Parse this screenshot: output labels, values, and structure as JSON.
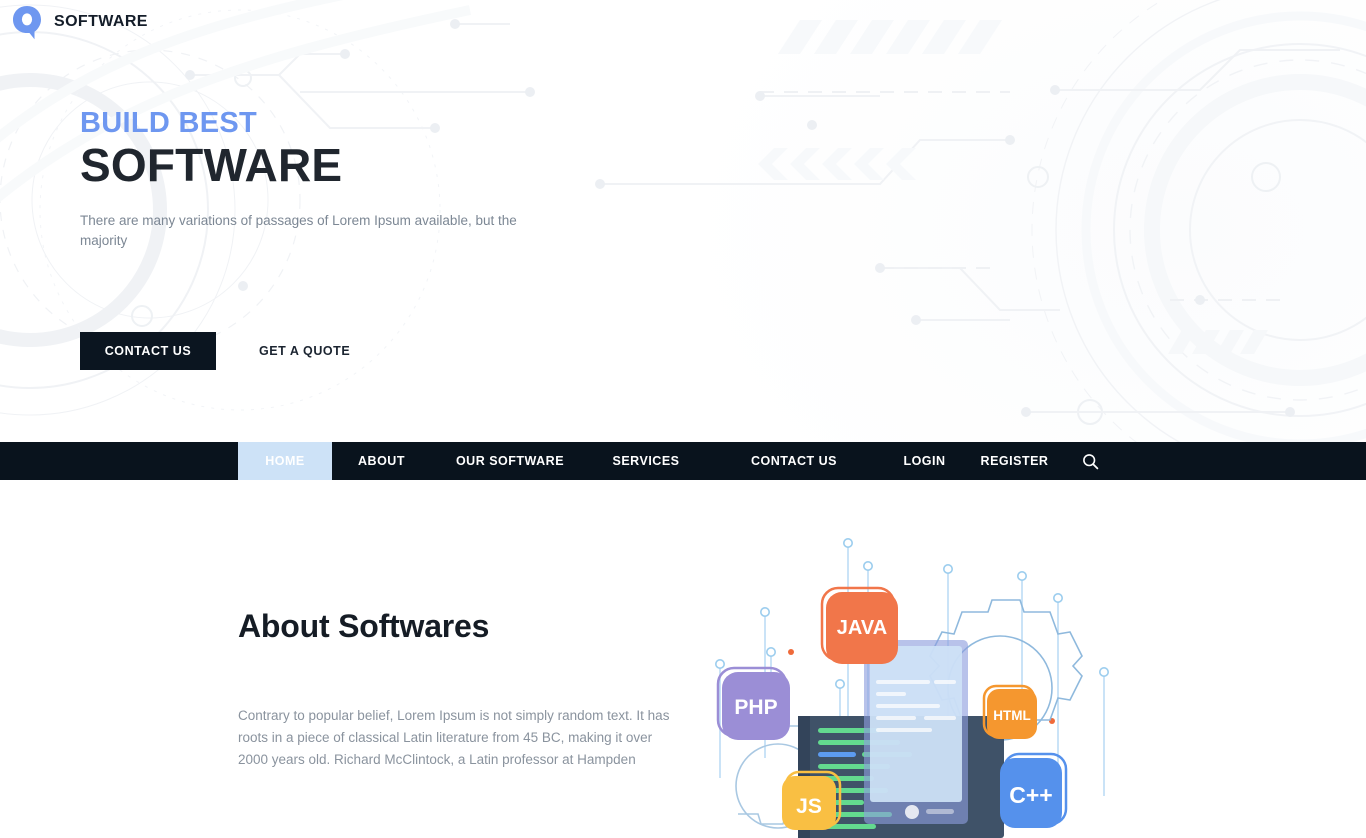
{
  "brand": {
    "mark_icon": "q-logo-icon",
    "name": "SOFTWARE"
  },
  "hero": {
    "eyebrow": "BUILD BEST",
    "title": "SOFTWARE",
    "subtitle": "There are many variations of passages of Lorem Ipsum available, but the majority",
    "primary_button": "CONTACT US",
    "secondary_button": "GET A QUOTE",
    "primary_button_color": "#0b1520",
    "eyebrow_color": "#6e97f0",
    "title_color": "#20262e"
  },
  "nav": {
    "background_color": "#09131d",
    "active_color": "#cde2f7",
    "search_icon": "search-icon",
    "items": [
      {
        "label": "HOME",
        "active": true
      },
      {
        "label": "ABOUT",
        "active": false
      },
      {
        "label": "OUR SOFTWARE",
        "active": false
      },
      {
        "label": "SERVICES",
        "active": false
      },
      {
        "label": "CONTACT US",
        "active": false
      },
      {
        "label": "LOGIN",
        "active": false
      },
      {
        "label": "REGISTER",
        "active": false
      }
    ]
  },
  "about": {
    "title": "About Softwares",
    "body": "Contrary to popular belief, Lorem Ipsum is not simply random text. It has roots in a piece of classical Latin literature from 45 BC, making it over 2000 years old. Richard McClintock, a Latin professor at Hampden",
    "illustration": {
      "name": "programming-languages-illustration",
      "badges": [
        {
          "label": "JAVA",
          "color": "#f1764a"
        },
        {
          "label": "PHP",
          "color": "#9b8ed6"
        },
        {
          "label": "HTML",
          "color": "#f5972f"
        },
        {
          "label": "JS",
          "color": "#f9bf43"
        },
        {
          "label": "C++",
          "color": "#5591ec"
        }
      ]
    }
  }
}
